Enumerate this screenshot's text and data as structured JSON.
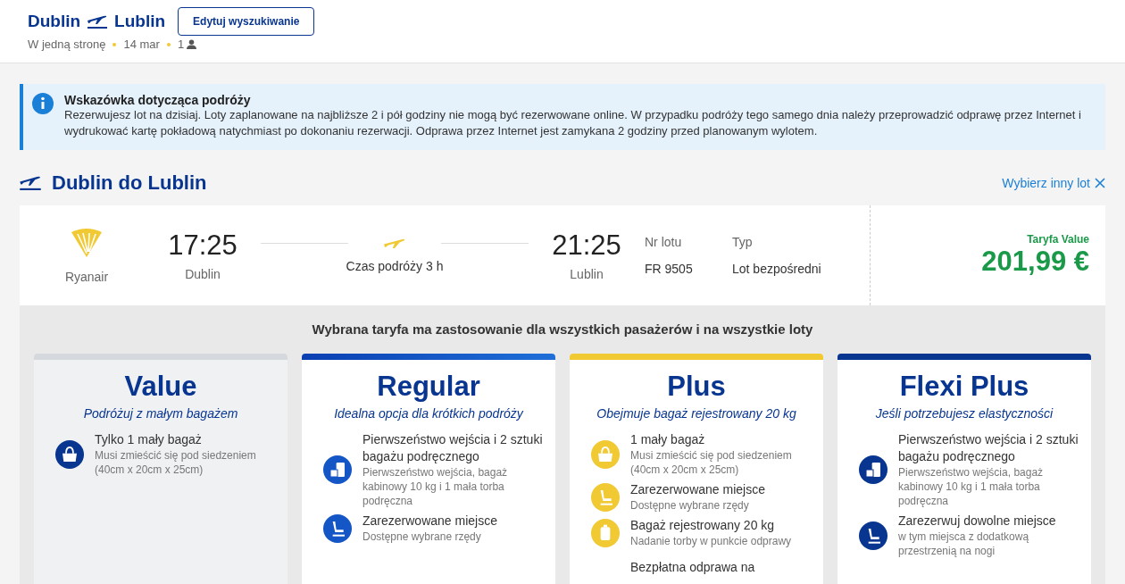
{
  "header": {
    "origin": "Dublin",
    "destination": "Lublin",
    "edit_button": "Edytuj wyszukiwanie",
    "trip_type": "W jedną stronę",
    "date": "14 mar",
    "passengers": "1"
  },
  "notice": {
    "title": "Wskazówka dotycząca podróży",
    "text": "Rezerwujesz lot na dzisiaj. Loty zaplanowane na najbliższe 2 i pół godziny nie mogą być rezerwowane online. W przypadku podróży tego samego dnia należy przeprowadzić odprawę przez Internet i wydrukować kartę pokładową natychmiast po dokonaniu rezerwacji. Odprawa przez Internet jest zamykana 2 godziny przed planowanym wylotem."
  },
  "section": {
    "title": "Dublin do Lublin",
    "change_link": "Wybierz inny lot"
  },
  "flight": {
    "airline": "Ryanair",
    "departure_time": "17:25",
    "departure_city": "Dublin",
    "duration": "Czas podróży 3 h",
    "arrival_time": "21:25",
    "arrival_city": "Lublin",
    "flight_number_label": "Nr lotu",
    "flight_number": "FR 9505",
    "type_label": "Typ",
    "type": "Lot bezpośredni",
    "fare_label": "Taryfa Value",
    "price": "201,99 €"
  },
  "fares_note": "Wybrana taryfa ma zastosowanie dla wszystkich pasażerów i na wszystkie loty",
  "fares": [
    {
      "kind": "value",
      "name": "Value",
      "tagline": "Podróżuj z małym bagażem",
      "features": [
        {
          "kind": "bag",
          "title": "Tylko 1 mały bagaż",
          "detail": "Musi zmieścić się pod siedzeniem (40cm x 20cm x 25cm)"
        }
      ]
    },
    {
      "kind": "regular",
      "name": "Regular",
      "tagline": "Idealna opcja dla krótkich podróży",
      "features": [
        {
          "kind": "luggage",
          "title": "Pierwszeństwo wejścia i 2 sztuki bagażu podręcznego",
          "detail": "Pierwszeństwo wejścia, bagaż kabinowy 10 kg i 1 mała torba podręczna"
        },
        {
          "kind": "seat",
          "title": "Zarezerwowane miejsce",
          "detail": "Dostępne wybrane rzędy"
        }
      ]
    },
    {
      "kind": "plus",
      "name": "Plus",
      "tagline": "Obejmuje bagaż rejestrowany 20 kg",
      "features": [
        {
          "kind": "bag",
          "title": "1 mały bagaż",
          "detail": "Musi zmieścić się pod siedzeniem (40cm x 20cm x 25cm)"
        },
        {
          "kind": "seat",
          "title": "Zarezerwowane miejsce",
          "detail": "Dostępne wybrane rzędy"
        },
        {
          "kind": "suitcase",
          "title": "Bagaż rejestrowany 20 kg",
          "detail": "Nadanie torby w punkcie odprawy"
        },
        {
          "kind": "none",
          "title": "Bezpłatna odprawa na"
        }
      ]
    },
    {
      "kind": "flexi",
      "name": "Flexi Plus",
      "tagline": "Jeśli potrzebujesz elastyczności",
      "features": [
        {
          "kind": "luggage",
          "title": "Pierwszeństwo wejścia i 2 sztuki bagażu podręcznego",
          "detail": "Pierwszeństwo wejścia, bagaż kabinowy 10 kg i 1 mała torba podręczna"
        },
        {
          "kind": "seat",
          "title": "Zarezerwuj dowolne miejsce",
          "detail": "w tym miejsca z dodatkową przestrzenią na nogi"
        }
      ]
    }
  ]
}
